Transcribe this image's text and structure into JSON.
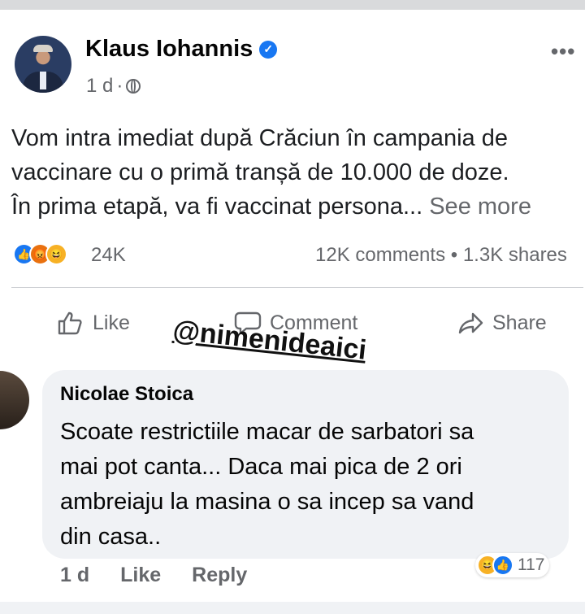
{
  "post": {
    "author": "Klaus Iohannis",
    "time": "1 d",
    "text_lines": [
      "Vom intra imediat după Crăciun în campania de",
      "vaccinare cu o primă tranșă de 10.000 de doze.",
      "În prima etapă, va fi vaccinat persona..."
    ],
    "see_more": "See more",
    "reaction_count": "24K",
    "comments": "12K comments",
    "separator": "•",
    "shares": "1.3K shares",
    "reaction_icons": [
      "like-icon",
      "angry-icon",
      "haha-icon"
    ]
  },
  "actions": {
    "like": "Like",
    "comment": "Comment",
    "share": "Share"
  },
  "watermark": "@nimenideaici",
  "comment": {
    "author": "Nicolae Stoica",
    "text_lines": [
      "Scoate restrictiile macar de sarbatori sa",
      "mai pot canta... Daca mai pica de 2 ori",
      "ambreiaju la masina o sa incep sa vand",
      "din casa.."
    ],
    "time": "1 d",
    "like": "Like",
    "reply": "Reply",
    "reaction_count": "117",
    "reaction_icons": [
      "haha-icon",
      "like-icon"
    ]
  },
  "colors": {
    "facebook_blue": "#1877f2",
    "secondary_text": "#65676b",
    "comment_bubble": "#f0f2f5"
  }
}
